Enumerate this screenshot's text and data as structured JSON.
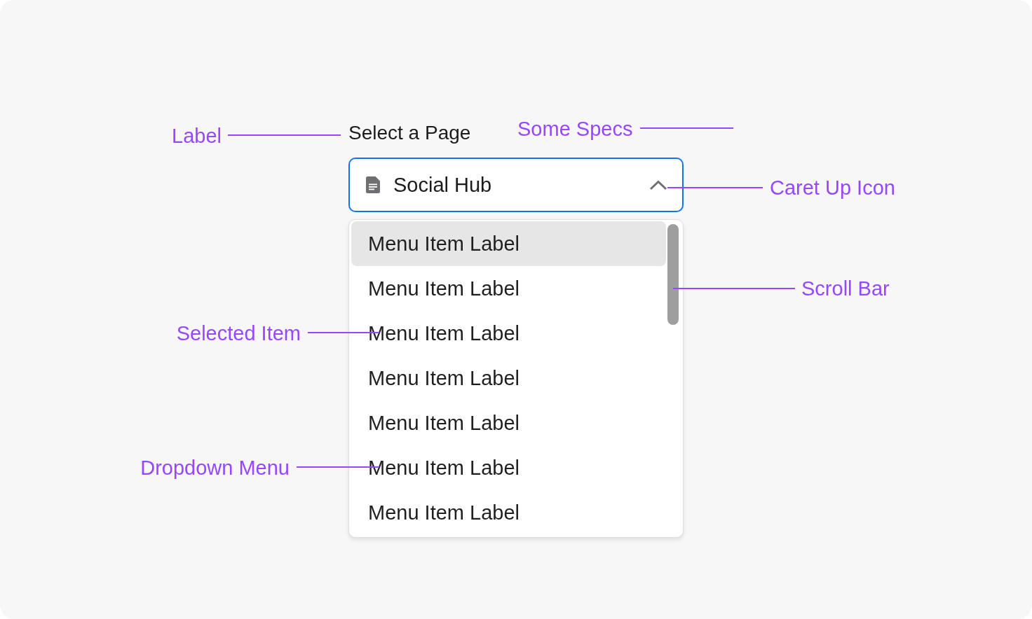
{
  "field": {
    "label": "Select a Page",
    "value": "Social Hub",
    "focused": true,
    "expanded": true
  },
  "menu": {
    "items": [
      {
        "label": "Menu Item Label",
        "selected": true
      },
      {
        "label": "Menu Item Label",
        "selected": false
      },
      {
        "label": "Menu Item Label",
        "selected": false
      },
      {
        "label": "Menu Item Label",
        "selected": false
      },
      {
        "label": "Menu Item Label",
        "selected": false
      },
      {
        "label": "Menu Item Label",
        "selected": false
      },
      {
        "label": "Menu Item Label",
        "selected": false
      }
    ]
  },
  "annotations": [
    {
      "kind": "label",
      "text": "Label"
    },
    {
      "kind": "specs",
      "text": "Some Specs"
    },
    {
      "kind": "caret",
      "text": "Caret Up Icon"
    },
    {
      "kind": "scrollbar",
      "text": "Scroll Bar"
    },
    {
      "kind": "selected-item",
      "text": "Selected Item"
    },
    {
      "kind": "menu",
      "text": "Dropdown Menu"
    }
  ]
}
